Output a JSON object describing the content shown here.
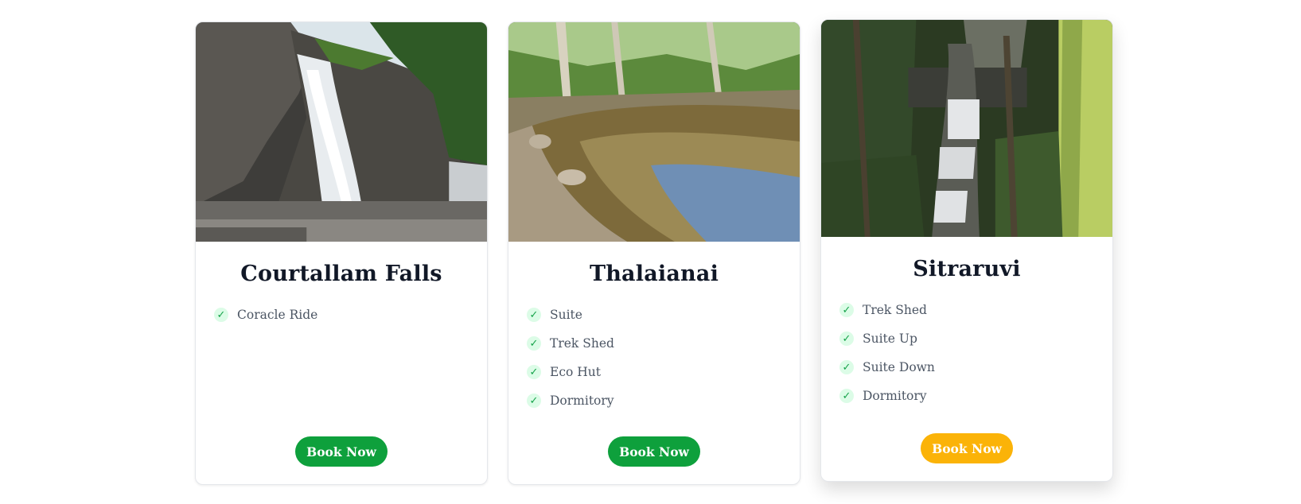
{
  "cards": [
    {
      "title": "Courtallam Falls",
      "features": [
        "Coracle Ride"
      ],
      "button_label": "Book Now",
      "button_color": "#0ea03c",
      "photo_icon": "waterfall-photo"
    },
    {
      "title": "Thalaianai",
      "features": [
        "Suite",
        "Trek Shed",
        "Eco Hut",
        "Dormitory"
      ],
      "button_label": "Book Now",
      "button_color": "#0ea03c",
      "photo_icon": "stream-photo"
    },
    {
      "title": "Sitraruvi",
      "features": [
        "Trek Shed",
        "Suite Up",
        "Suite Down",
        "Dormitory"
      ],
      "button_label": "Book Now",
      "button_color": "#fbb308",
      "photo_icon": "forest-waterfall-photo"
    }
  ],
  "icons": {
    "check": "✓"
  }
}
